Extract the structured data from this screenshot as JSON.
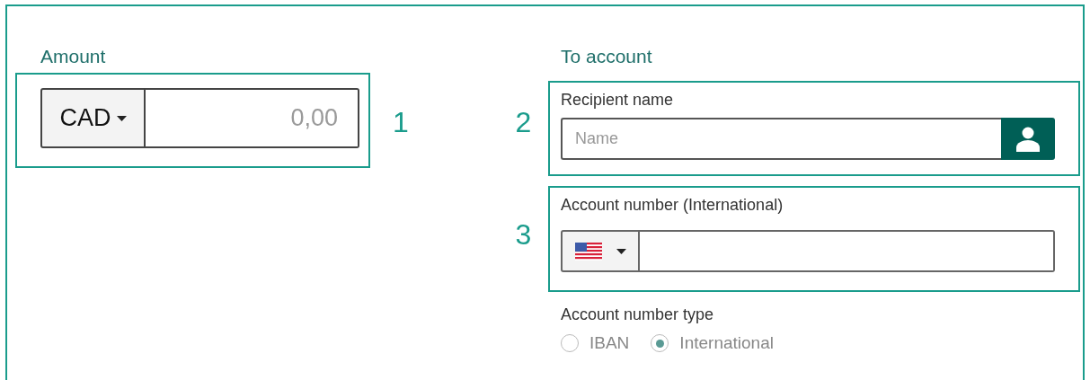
{
  "amount": {
    "label": "Amount",
    "marker": "1",
    "currency": "CAD",
    "placeholder": "0,00"
  },
  "to_account": {
    "label": "To account",
    "recipient": {
      "marker": "2",
      "label": "Recipient name",
      "placeholder": "Name"
    },
    "account_number": {
      "marker": "3",
      "label": "Account number (International)"
    },
    "type": {
      "label": "Account number type",
      "options": [
        {
          "label": "IBAN",
          "selected": false
        },
        {
          "label": "International",
          "selected": true
        }
      ]
    }
  }
}
